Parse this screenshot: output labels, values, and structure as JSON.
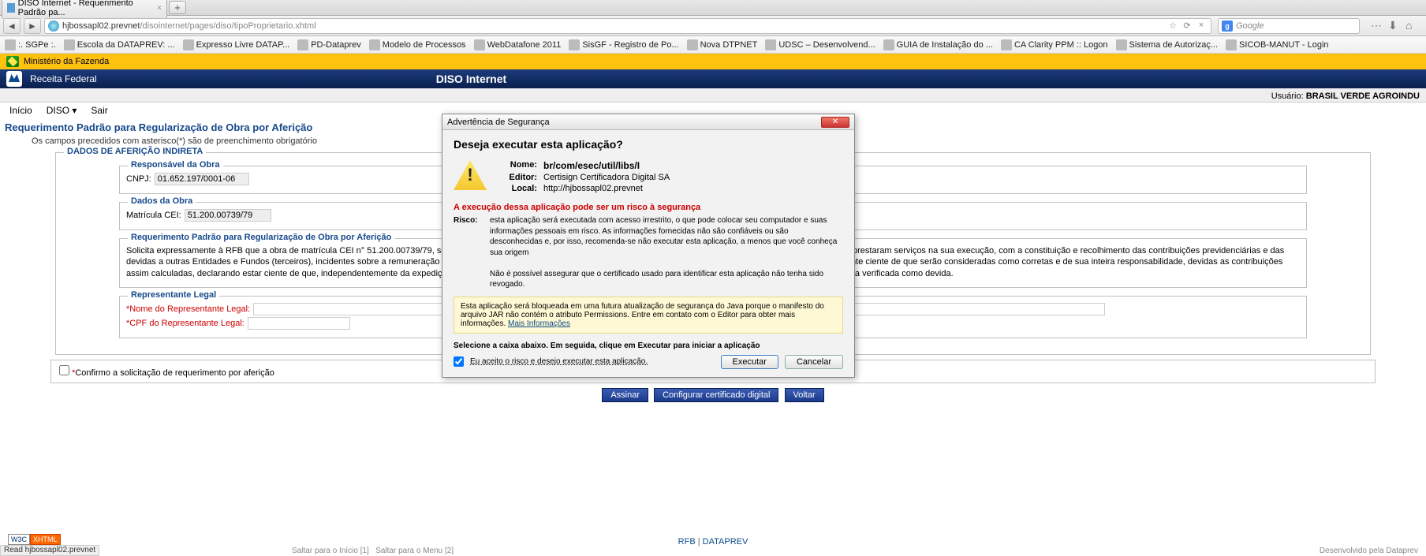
{
  "browser": {
    "tab_title": "DISO Internet - Requerimento Padrão pa...",
    "url_host": "hjbossapl02.prevnet",
    "url_path": "/disointernet/pages/diso/tipoProprietario.xhtml",
    "search_placeholder": "Google",
    "status_bar": "Read hjbossapl02.prevnet"
  },
  "bookmarks": [
    ":. SGPe :.",
    "Escola da DATAPREV: ...",
    "Expresso Livre DATAP...",
    "PD-Dataprev",
    "Modelo de Processos",
    "WebDatafone 2011",
    "SisGF - Registro de Po...",
    "Nova DTPNET",
    "UDSC – Desenvolvend...",
    "GUIA de Instalação do ...",
    "CA Clarity PPM :: Logon",
    "Sistema de Autorizaç...",
    "SICOB-MANUT - Login"
  ],
  "gov_bar": "Ministério da Fazenda",
  "header": {
    "org": "Receita Federal",
    "app": "DISO Internet"
  },
  "menu": [
    "Início",
    "DISO",
    "Sair"
  ],
  "page": {
    "title": "Requerimento Padrão para Regularização de Obra por Aferição",
    "subtitle": "Os campos precedidos com asterisco(*) são de preenchimento obrigatório",
    "user_label": "Usuário:",
    "user_name": "BRASIL VERDE AGROINDU"
  },
  "dados_afericao": {
    "legend": "DADOS DE AFERIÇÃO INDIRETA",
    "responsavel": {
      "legend": "Responsável da Obra",
      "cnpj_label": "CNPJ:",
      "cnpj_value": "01.652.197/0001-06"
    },
    "dados_obra": {
      "legend": "Dados da Obra",
      "matricula_label": "Matrícula CEI:",
      "matricula_value": "51.200.00739/79"
    },
    "reg_padrao": {
      "legend": "Requerimento Padrão para Regularização de Obra por Aferição",
      "text": "Solicita expressamente à RFB que a obra de matrícula CEI n° 51.200.00739/79, sob sua responsabilidade, seja regularizada mediante aferição indireta da remuneração dos segurados que prestaram serviços na sua execução, com a constituição e recolhimento das contribuições previdenciárias e das devidas a outras Entidades e Fundos (terceiros), incidentes sobre a remuneração apuradas por aferição com base na área construída e no padrão de construção da obra, ficando o requerente ciente de que serão consideradas como corretas e de sua inteira responsabilidade, devidas as contribuições assim calculadas, declarando estar ciente de que, independentemente da expedição de CND, fica ressalvado à RFB o direito de cobrar qualquer importância que, posteriormente, seja por ela verificada como devida."
    },
    "representante": {
      "legend": "Representante Legal",
      "nome_label": "*Nome do Representante Legal:",
      "cpf_label": "*CPF do Representante Legal:"
    }
  },
  "confirm": {
    "label": "Confirmo a solicitação de requerimento por aferição"
  },
  "buttons": {
    "assinar": "Assinar",
    "config": "Configurar certificado digital",
    "voltar": "Voltar"
  },
  "footer": {
    "rfb": "RFB",
    "dataprev": "DATAPREV",
    "skip1": "Saltar para o Início [1]",
    "skip2": "Saltar para o Menu [2]",
    "dev": "Desenvolvido pela Dataprev"
  },
  "modal": {
    "title": "Advertência de Segurança",
    "question": "Deseja executar esta aplicação?",
    "nome_k": "Nome:",
    "nome_v": "br/com/esec/util/libs/I",
    "editor_k": "Editor:",
    "editor_v": "Certisign Certificadora Digital SA",
    "local_k": "Local:",
    "local_v": "http://hjbossapl02.prevnet",
    "risk_h": "A execução dessa aplicação pode ser um risco à segurança",
    "risco_k": "Risco:",
    "risco_v": "esta aplicação será executada com acesso irrestrito, o que pode colocar seu computador e suas informações pessoais em risco. As informações fornecidas não são confiáveis ou são desconhecidas e, por isso, recomenda-se não executar esta aplicação, a menos que você conheça sua origem",
    "risco_v2": "Não é possível assegurar que o certificado usado para identificar esta aplicação não tenha sido revogado.",
    "warn_box": "Esta aplicação será bloqueada em uma futura atualização de segurança do Java porque o manifesto do arquivo JAR não contém o atributo Permissions. Entre em contato com o Editor para obter mais informações.",
    "warn_link": "Mais Informações",
    "instr": "Selecione a caixa abaixo. Em seguida, clique em Executar para iniciar a aplicação",
    "accept": "Eu aceito o risco e desejo executar esta aplicação.",
    "btn_exec": "Executar",
    "btn_cancel": "Cancelar"
  }
}
